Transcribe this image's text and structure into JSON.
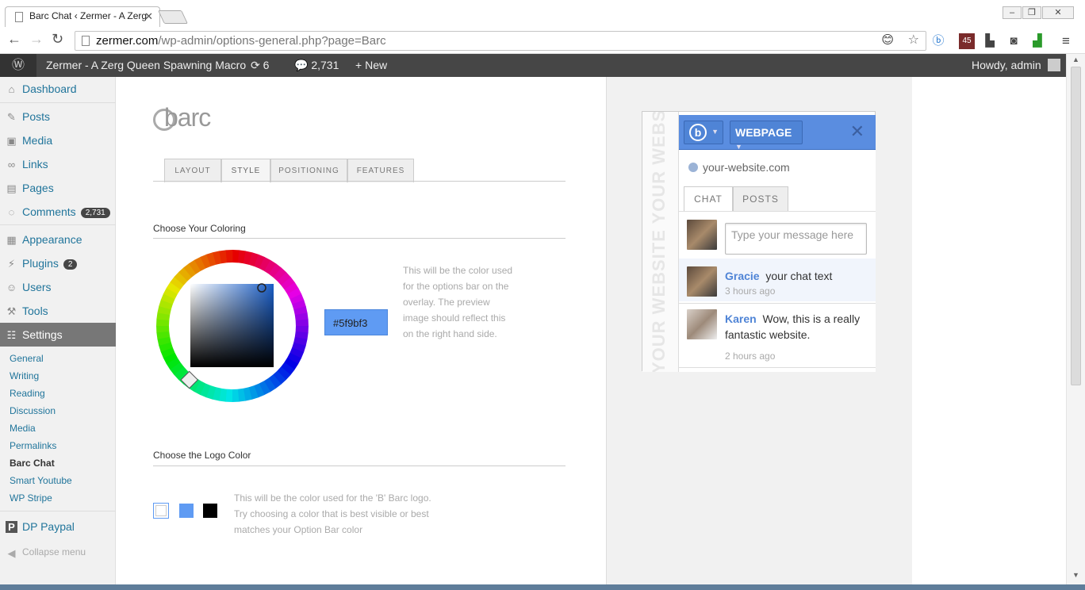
{
  "browser": {
    "tab_title": "Barc Chat ‹ Zermer - A Zerg",
    "url_host": "zermer.com",
    "url_path": "/wp-admin/options-general.php?page=Barc",
    "ext_badge": "45"
  },
  "adminbar": {
    "site_name": "Zermer - A Zerg Queen Spawning Macro",
    "updates": "6",
    "comments": "2,731",
    "new": "New",
    "howdy": "Howdy, admin"
  },
  "sidebar": {
    "items": [
      {
        "label": "Dashboard"
      },
      {
        "label": "Posts"
      },
      {
        "label": "Media"
      },
      {
        "label": "Links"
      },
      {
        "label": "Pages"
      },
      {
        "label": "Comments",
        "badge": "2,731"
      },
      {
        "label": "Appearance"
      },
      {
        "label": "Plugins",
        "badge": "2"
      },
      {
        "label": "Users"
      },
      {
        "label": "Tools"
      },
      {
        "label": "Settings"
      }
    ],
    "settings_sub": [
      "General",
      "Writing",
      "Reading",
      "Discussion",
      "Media",
      "Permalinks",
      "Barc Chat",
      "Smart Youtube",
      "WP Stripe"
    ],
    "dp_paypal": "DP Paypal",
    "collapse": "Collapse menu"
  },
  "main": {
    "logo": "barc",
    "tabs": [
      "LAYOUT",
      "STYLE",
      "POSITIONING",
      "FEATURES"
    ],
    "coloring_title": "Choose Your Coloring",
    "coloring_desc": "This will be the color used for the options bar on the overlay. The preview image should reflect this on the right hand side.",
    "hex_value": "#5f9bf3",
    "logo_color_title": "Choose the Logo Color",
    "logo_color_desc": "This will be the color used for the 'B' Barc logo. Try choosing a color that is best visible or best matches your Option Bar color",
    "swatches": [
      "#ffffff",
      "#5f9bf3",
      "#000000"
    ]
  },
  "preview": {
    "strip_text": "YOUR WEBSITE   YOUR WEBSITE",
    "webpage_btn": "WEBPAGE",
    "site": "your-website.com",
    "tabs": [
      "CHAT",
      "POSTS"
    ],
    "placeholder": "Type your message here",
    "messages": [
      {
        "user": "Gracie",
        "text": "your chat text",
        "time": "3 hours ago"
      },
      {
        "user": "Karen",
        "text": "Wow, this is a really fantastic website.",
        "time": "2 hours ago"
      }
    ]
  }
}
